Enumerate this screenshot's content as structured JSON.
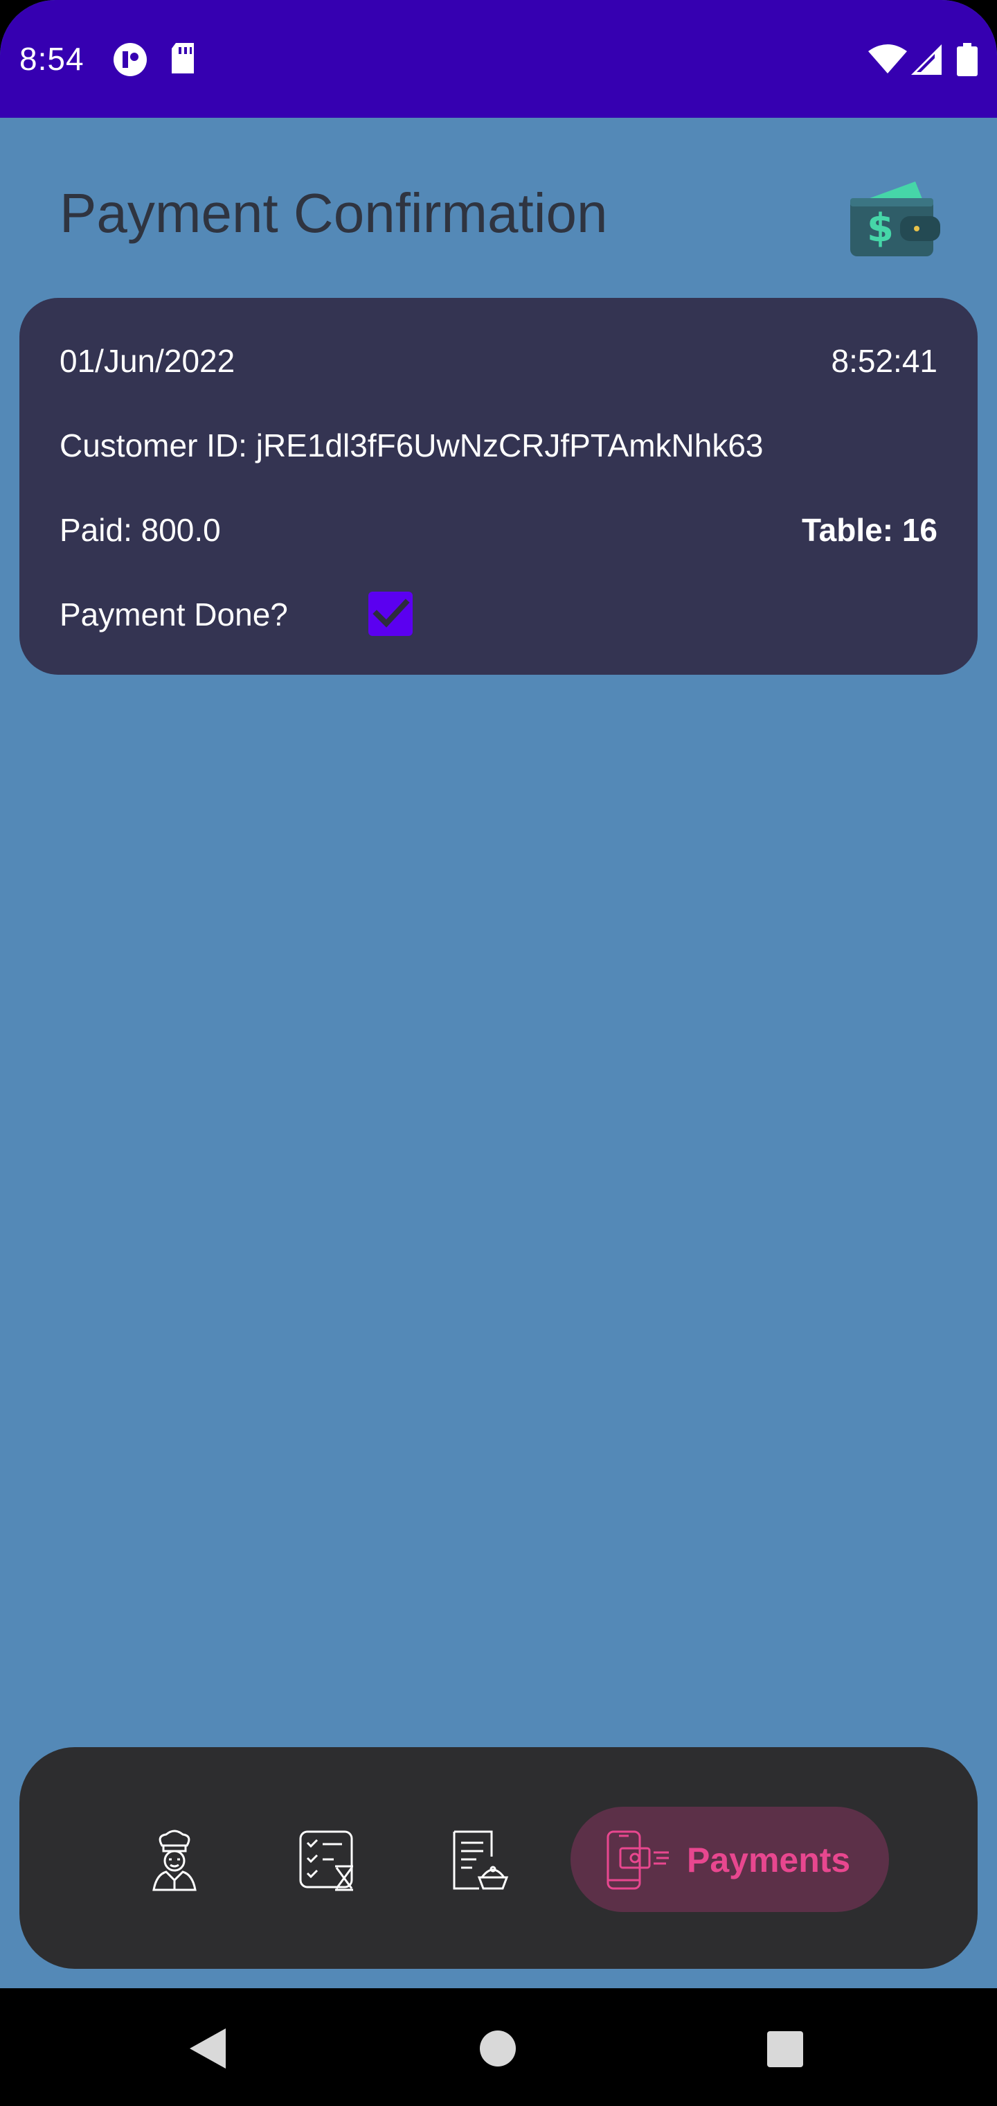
{
  "status_bar": {
    "time": "8:54"
  },
  "header": {
    "title": "Payment Confirmation",
    "icon": "wallet-icon"
  },
  "payment": {
    "date": "01/Jun/2022",
    "time": "8:52:41",
    "customer": "Customer ID: jRE1dl3fF6UwNzCRJfPTAmkNhk63",
    "paid": "Paid: 800.0",
    "table": "Table: 16",
    "done_label": "Payment Done?",
    "done_checked": true
  },
  "bottom_nav": {
    "items": [
      {
        "icon": "chef-icon"
      },
      {
        "icon": "checklist-hourglass-icon"
      },
      {
        "icon": "menu-document-icon"
      },
      {
        "icon": "mobile-payment-icon",
        "label": "Payments",
        "active": true
      }
    ]
  },
  "colors": {
    "background": "#5489b7",
    "status_bar": "#3600b1",
    "card": "#343452",
    "nav": "#2d2d2f",
    "accent": "#e8478f",
    "checkbox": "#5b00f0"
  }
}
